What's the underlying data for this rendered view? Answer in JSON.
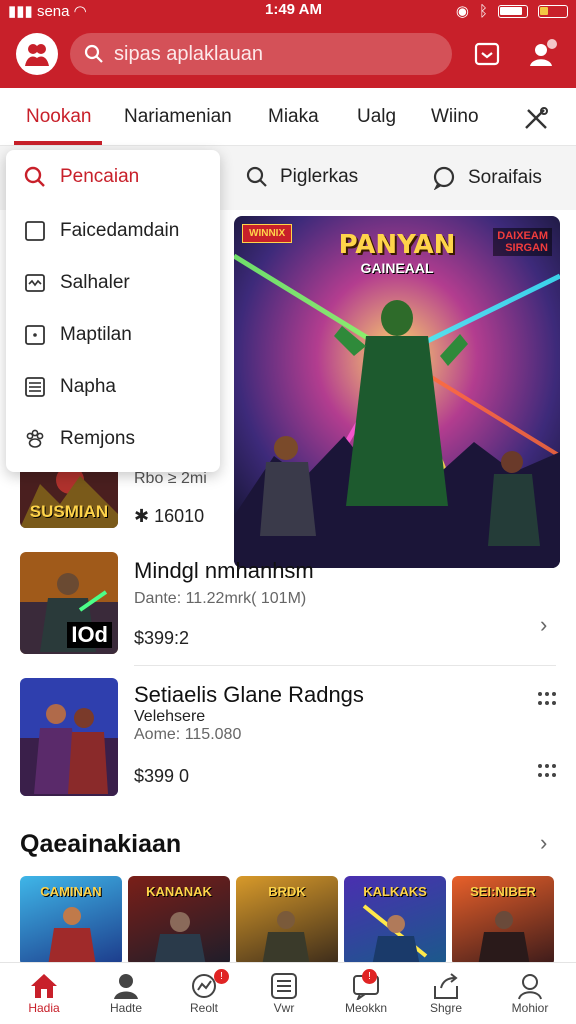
{
  "status_bar": {
    "carrier": "sena",
    "time": "1:49 AM"
  },
  "header": {
    "search_placeholder": "sipas aplaklauan"
  },
  "tabs": [
    {
      "label": "Nookan"
    },
    {
      "label": "Nariamenian"
    },
    {
      "label": "Miaka"
    },
    {
      "label": "Ualg"
    },
    {
      "label": "Wiino"
    }
  ],
  "subbar": {
    "item1": "Piglerkas",
    "item2": "Soraifais"
  },
  "dropdown": {
    "items": [
      {
        "label": "Pencaian",
        "icon": "search-icon"
      },
      {
        "label": "Faicedamdain",
        "icon": "square-icon"
      },
      {
        "label": "Salhaler",
        "icon": "wave-box-icon"
      },
      {
        "label": "Maptilan",
        "icon": "dot-box-icon"
      },
      {
        "label": "Napha",
        "icon": "list-box-icon"
      },
      {
        "label": "Remjons",
        "icon": "paw-icon"
      }
    ]
  },
  "hero": {
    "badge": "WINNIX",
    "title": "PANYAN",
    "subtitle": "GAINEAAL",
    "tag": "DAIXEAM\nSIRGAN"
  },
  "partial_row": {
    "meta": "Rbo ≥ 2mi",
    "price": "✱ 16010",
    "thumb_caption": "SUSMIAN"
  },
  "rows": [
    {
      "title": "Mindgl nmhanhsm",
      "meta": "Dante: 11.22mrk( 101M)",
      "price": "$399:2",
      "thumb_caption": "IOd"
    },
    {
      "title": "Setiaelis Glane Radngs",
      "subtitle": "Velehsere",
      "meta": "Aome: 115.080",
      "price": "$399 0"
    }
  ],
  "section": {
    "title": "Qaeainakiaan"
  },
  "cards": [
    {
      "label": "CAMINAN"
    },
    {
      "label": "KANANAK"
    },
    {
      "label": "BRDK"
    },
    {
      "label": "KALKAKS"
    },
    {
      "label": "SEI:NIBER"
    }
  ],
  "bottom_nav": [
    {
      "label": "Hadia",
      "icon": "home-icon"
    },
    {
      "label": "Hadte",
      "icon": "person-icon"
    },
    {
      "label": "Reolt",
      "icon": "graph-icon",
      "badge": "!"
    },
    {
      "label": "Vwr",
      "icon": "list-icon"
    },
    {
      "label": "Meokkn",
      "icon": "chat-icon",
      "badge": "!"
    },
    {
      "label": "Shgre",
      "icon": "share-icon"
    },
    {
      "label": "Mohior",
      "icon": "profile-icon"
    }
  ]
}
